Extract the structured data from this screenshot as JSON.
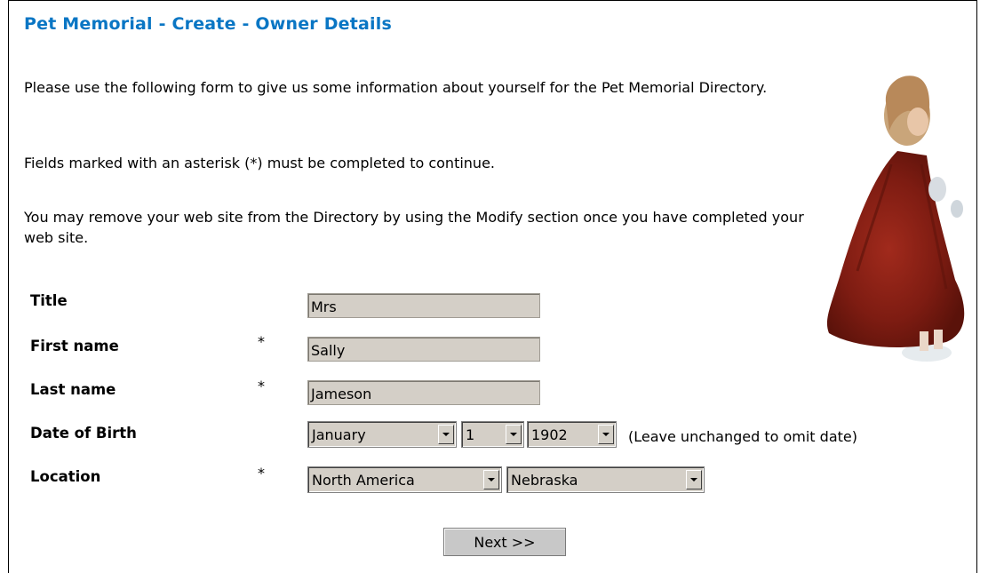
{
  "page": {
    "title": "Pet Memorial - Create - Owner Details",
    "intro": "Please use the following form to give us some information about yourself for the Pet Memorial Directory.",
    "required_note": "Fields marked with an asterisk (*) must be completed to continue.",
    "modify_note": "You may remove your web site from the Directory by using the Modify section once you have completed your web site."
  },
  "form": {
    "title_label": "Title",
    "title_value": "Mrs",
    "first_label": "First name",
    "first_value": "Sally",
    "last_label": "Last name",
    "last_value": "Jameson",
    "dob_label": "Date of Birth",
    "dob_month": "January",
    "dob_day": "1",
    "dob_year": "1902",
    "dob_hint": "(Leave unchanged to omit date)",
    "location_label": "Location",
    "region": "North America",
    "state": "Nebraska",
    "asterisk": "*",
    "next_label": "Next >>"
  },
  "colors": {
    "title": "#0a76c4",
    "field_bg": "#d4cfc7"
  }
}
